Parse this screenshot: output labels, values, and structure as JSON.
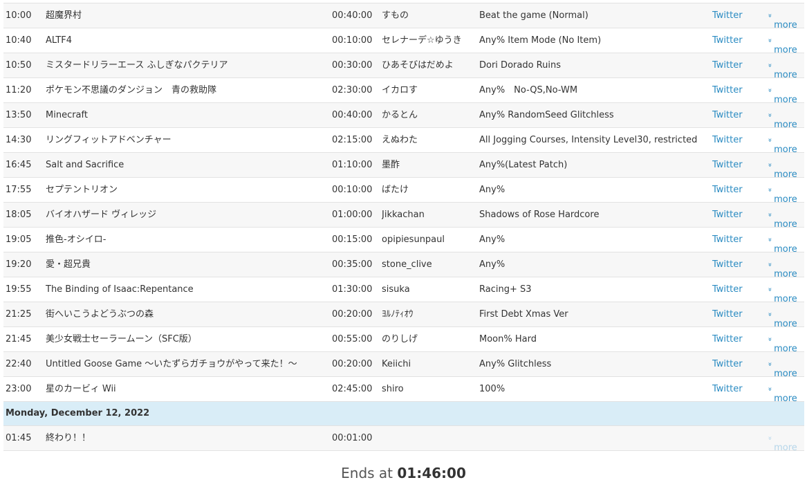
{
  "schedule": {
    "rows_before": [
      {
        "time": "10:00",
        "game": "超魔界村",
        "estimate": "00:40:00",
        "runner": "すもの",
        "category": "Beat the game (Normal)",
        "link": "Twitter",
        "more": "more"
      },
      {
        "time": "10:40",
        "game": "ALTF4",
        "estimate": "00:10:00",
        "runner": "セレナーデ☆ゆうき",
        "category": "Any% Item Mode (No Item)",
        "link": "Twitter",
        "more": "more"
      },
      {
        "time": "10:50",
        "game": "ミスタードリラーエース ふしぎなパクテリア",
        "estimate": "00:30:00",
        "runner": "ひあそびはだめよ",
        "category": "Dori Dorado Ruins",
        "link": "Twitter",
        "more": "more"
      },
      {
        "time": "11:20",
        "game": "ポケモン不思議のダンジョン　青の救助隊",
        "estimate": "02:30:00",
        "runner": "イカロす",
        "category": "Any%　No-QS,No-WM",
        "link": "Twitter",
        "more": "more"
      },
      {
        "time": "13:50",
        "game": "Minecraft",
        "estimate": "00:40:00",
        "runner": "かるとん",
        "category": "Any% RandomSeed Glitchless",
        "link": "Twitter",
        "more": "more"
      },
      {
        "time": "14:30",
        "game": "リングフィットアドベンチャー",
        "estimate": "02:15:00",
        "runner": "えぬわた",
        "category": "All Jogging Courses, Intensity Level30, restricted",
        "link": "Twitter",
        "more": "more"
      },
      {
        "time": "16:45",
        "game": "Salt and Sacrifice",
        "estimate": "01:10:00",
        "runner": "墨酢",
        "category": "Any%(Latest Patch)",
        "link": "Twitter",
        "more": "more"
      },
      {
        "time": "17:55",
        "game": "セプテントリオン",
        "estimate": "00:10:00",
        "runner": "ばたけ",
        "category": "Any%",
        "link": "Twitter",
        "more": "more"
      },
      {
        "time": "18:05",
        "game": "バイオハザード ヴィレッジ",
        "estimate": "01:00:00",
        "runner": "Jikkachan",
        "category": "Shadows of Rose Hardcore",
        "link": "Twitter",
        "more": "more"
      },
      {
        "time": "19:05",
        "game": "推色-オシイロ-",
        "estimate": "00:15:00",
        "runner": "opipiesunpaul",
        "category": "Any%",
        "link": "Twitter",
        "more": "more"
      },
      {
        "time": "19:20",
        "game": "愛・超兄貴",
        "estimate": "00:35:00",
        "runner": "stone_clive",
        "category": "Any%",
        "link": "Twitter",
        "more": "more"
      },
      {
        "time": "19:55",
        "game": "The Binding of Isaac:Repentance",
        "estimate": "01:30:00",
        "runner": "sisuka",
        "category": "Racing+ S3",
        "link": "Twitter",
        "more": "more"
      },
      {
        "time": "21:25",
        "game": "街へいこうよどうぶつの森",
        "estimate": "00:20:00",
        "runner": "ﾖﾙﾉﾃｨｵｳ",
        "category": "First Debt Xmas Ver",
        "link": "Twitter",
        "more": "more"
      },
      {
        "time": "21:45",
        "game": "美少女戦士セーラームーン（SFC版）",
        "estimate": "00:55:00",
        "runner": "のりしげ",
        "category": "Moon% Hard",
        "link": "Twitter",
        "more": "more"
      },
      {
        "time": "22:40",
        "game": "Untitled Goose Game ～いたずらガチョウがやって来た！～",
        "estimate": "00:20:00",
        "runner": "Keiichi",
        "category": "Any% Glitchless",
        "link": "Twitter",
        "more": "more"
      },
      {
        "time": "23:00",
        "game": "星のカービィ Wii",
        "estimate": "02:45:00",
        "runner": "shiro",
        "category": "100%",
        "link": "Twitter",
        "more": "more"
      }
    ],
    "day_header": "Monday, December 12, 2022",
    "rows_after": [
      {
        "time": "01:45",
        "game": "終わり！！",
        "estimate": "00:01:00",
        "runner": "",
        "category": "",
        "link": "",
        "more": "more"
      }
    ]
  },
  "footer": {
    "prefix": "Ends at",
    "time": "01:46:00"
  },
  "icons": {
    "more": "double-chevron-down-icon"
  },
  "colors": {
    "link": "#2a8bc2",
    "day_header_bg": "#d9edf7",
    "row_alt_bg": "#f7f7f7"
  }
}
